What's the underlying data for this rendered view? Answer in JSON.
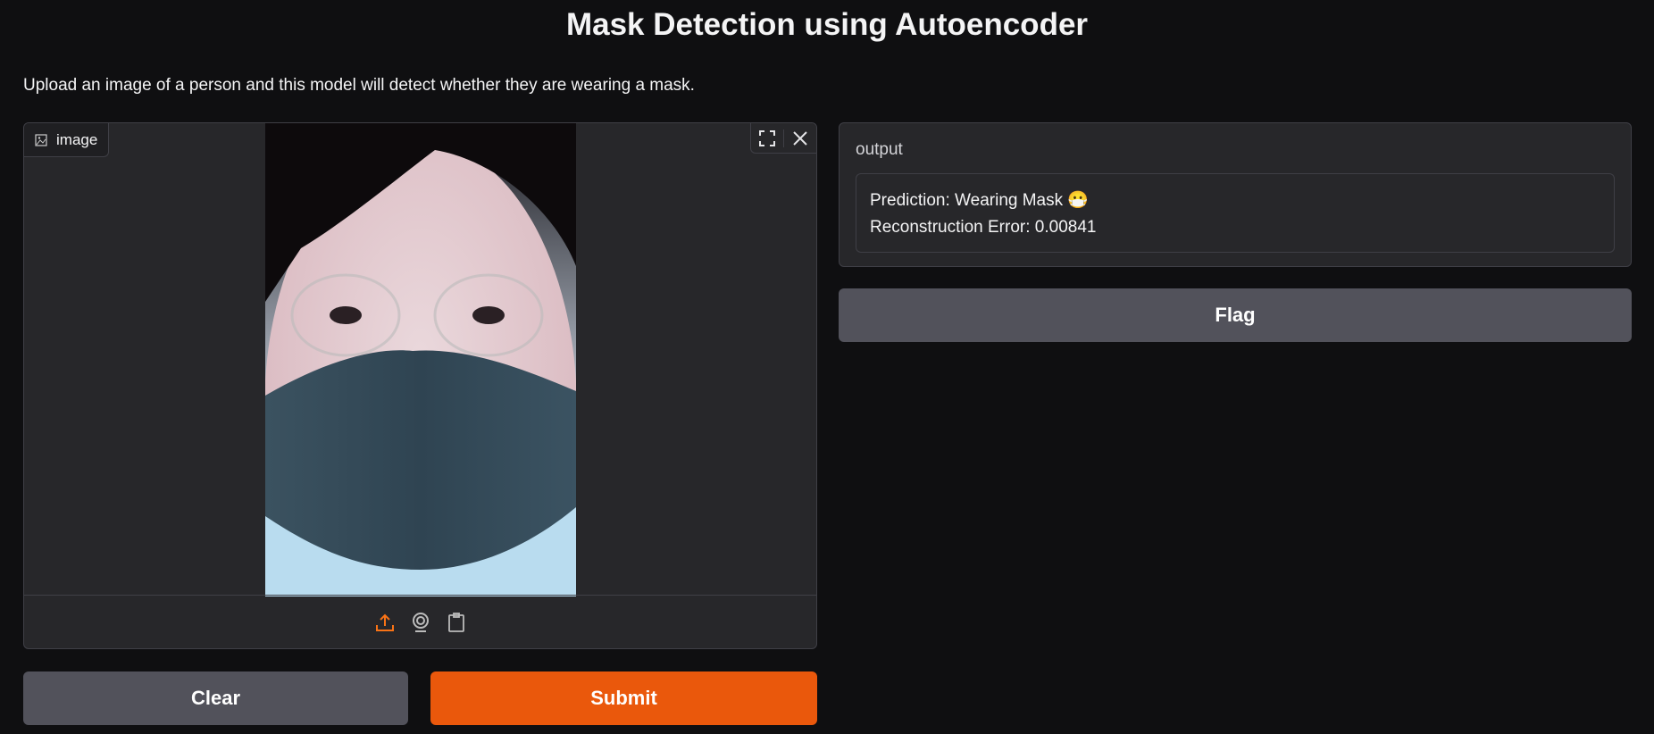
{
  "header": {
    "title": "Mask Detection using Autoencoder",
    "description": "Upload an image of a person and this model will detect whether they are wearing a mask."
  },
  "input": {
    "label": "image",
    "icons": [
      "image-icon",
      "fullscreen-icon",
      "close-icon",
      "upload-icon",
      "webcam-icon",
      "clipboard-icon"
    ],
    "accent": "#f97316"
  },
  "output": {
    "label": "output",
    "prediction": "Prediction: Wearing Mask 😷",
    "error": "Reconstruction Error: 0.00841"
  },
  "buttons": {
    "clear": "Clear",
    "submit": "Submit",
    "flag": "Flag"
  },
  "colors": {
    "background": "#0f0f11",
    "panel": "#27272a",
    "primary": "#ea580c",
    "secondary": "#52525b"
  }
}
